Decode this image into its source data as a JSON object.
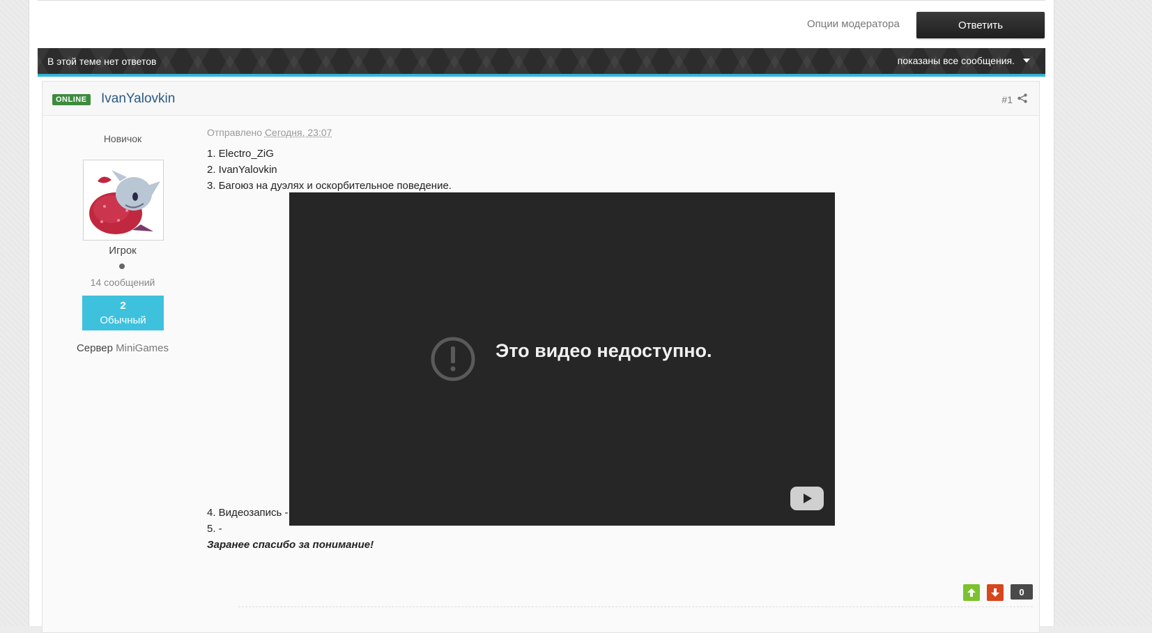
{
  "toolbar": {
    "moderator_options": "Опции модератора",
    "reply_label": "Ответить"
  },
  "topic_bar": {
    "no_replies": "В этой теме нет ответов",
    "filter_label": "показаны все сообщения."
  },
  "post": {
    "online_badge": "ONLINE",
    "author": "IvanYalovkin",
    "number": "#1",
    "author_title": "Новичок",
    "group": "Игрок",
    "post_count": "14 сообщений",
    "reputation_value": "2",
    "reputation_label": "Обычный",
    "server_label": "Сервер",
    "server_value": "MiniGames",
    "sent_label": "Отправлено",
    "sent_time": "Сегодня, 23:07",
    "lines": [
      "1. Electro_ZiG",
      "2. IvanYalovkin",
      "3. Багоюз на дуэлях и оскорбительное поведение.",
      "4. Видеозапись -",
      "5. -"
    ],
    "video_message": "Это видео недоступно.",
    "thanks": "Заранее спасибо за понимание!",
    "vote_count": "0"
  },
  "colors": {
    "accent": "#33b5d8",
    "online": "#3d8b3d",
    "reputation": "#3ec1dd",
    "vote_up": "#7cc22e",
    "vote_down": "#d8461d"
  },
  "icons": [
    "share-icon",
    "caret-down-icon",
    "warning-icon",
    "youtube-icon",
    "arrow-up-icon",
    "arrow-down-icon"
  ]
}
